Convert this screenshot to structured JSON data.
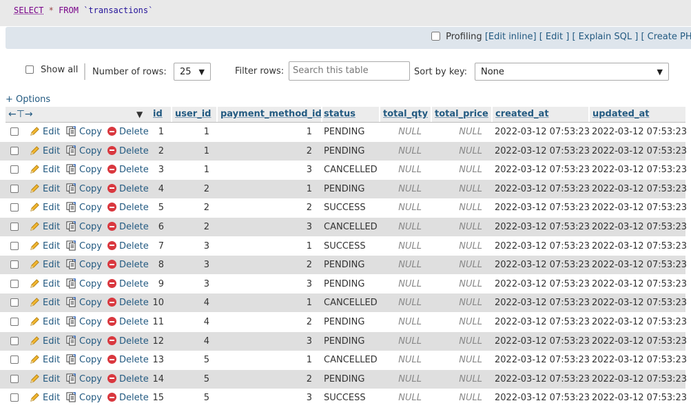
{
  "query": {
    "select_kw": "SELECT",
    "star": "*",
    "from_kw": "FROM",
    "table": "`transactions`"
  },
  "profiling": {
    "label": "Profiling",
    "edit_inline": "[Edit inline]",
    "edit": "[ Edit ]",
    "explain": "[ Explain SQL ]",
    "create_php": "[ Create PHP c"
  },
  "nav": {
    "show_all": "Show all",
    "rows_label": "Number of rows:",
    "rows_value": "25",
    "filter_label": "Filter rows:",
    "filter_placeholder": "Search this table",
    "sort_label": "Sort by key:",
    "sort_value": "None"
  },
  "options_link": "+ Options",
  "columns": [
    "id",
    "user_id",
    "payment_method_id",
    "status",
    "total_qty",
    "total_price",
    "created_at",
    "updated_at"
  ],
  "actions": {
    "edit": "Edit",
    "copy": "Copy",
    "delete": "Delete"
  },
  "rows": [
    {
      "id": "1",
      "user_id": "1",
      "payment_method_id": "1",
      "status": "PENDING",
      "total_qty": "NULL",
      "total_price": "NULL",
      "created_at": "2022-03-12 07:53:23",
      "updated_at": "2022-03-12 07:53:23"
    },
    {
      "id": "2",
      "user_id": "1",
      "payment_method_id": "2",
      "status": "PENDING",
      "total_qty": "NULL",
      "total_price": "NULL",
      "created_at": "2022-03-12 07:53:23",
      "updated_at": "2022-03-12 07:53:23"
    },
    {
      "id": "3",
      "user_id": "1",
      "payment_method_id": "3",
      "status": "CANCELLED",
      "total_qty": "NULL",
      "total_price": "NULL",
      "created_at": "2022-03-12 07:53:23",
      "updated_at": "2022-03-12 07:53:23"
    },
    {
      "id": "4",
      "user_id": "2",
      "payment_method_id": "1",
      "status": "PENDING",
      "total_qty": "NULL",
      "total_price": "NULL",
      "created_at": "2022-03-12 07:53:23",
      "updated_at": "2022-03-12 07:53:23"
    },
    {
      "id": "5",
      "user_id": "2",
      "payment_method_id": "2",
      "status": "SUCCESS",
      "total_qty": "NULL",
      "total_price": "NULL",
      "created_at": "2022-03-12 07:53:23",
      "updated_at": "2022-03-12 07:53:23"
    },
    {
      "id": "6",
      "user_id": "2",
      "payment_method_id": "3",
      "status": "CANCELLED",
      "total_qty": "NULL",
      "total_price": "NULL",
      "created_at": "2022-03-12 07:53:23",
      "updated_at": "2022-03-12 07:53:23"
    },
    {
      "id": "7",
      "user_id": "3",
      "payment_method_id": "1",
      "status": "SUCCESS",
      "total_qty": "NULL",
      "total_price": "NULL",
      "created_at": "2022-03-12 07:53:23",
      "updated_at": "2022-03-12 07:53:23"
    },
    {
      "id": "8",
      "user_id": "3",
      "payment_method_id": "2",
      "status": "PENDING",
      "total_qty": "NULL",
      "total_price": "NULL",
      "created_at": "2022-03-12 07:53:23",
      "updated_at": "2022-03-12 07:53:23"
    },
    {
      "id": "9",
      "user_id": "3",
      "payment_method_id": "3",
      "status": "PENDING",
      "total_qty": "NULL",
      "total_price": "NULL",
      "created_at": "2022-03-12 07:53:23",
      "updated_at": "2022-03-12 07:53:23"
    },
    {
      "id": "10",
      "user_id": "4",
      "payment_method_id": "1",
      "status": "CANCELLED",
      "total_qty": "NULL",
      "total_price": "NULL",
      "created_at": "2022-03-12 07:53:23",
      "updated_at": "2022-03-12 07:53:23"
    },
    {
      "id": "11",
      "user_id": "4",
      "payment_method_id": "2",
      "status": "PENDING",
      "total_qty": "NULL",
      "total_price": "NULL",
      "created_at": "2022-03-12 07:53:23",
      "updated_at": "2022-03-12 07:53:23"
    },
    {
      "id": "12",
      "user_id": "4",
      "payment_method_id": "3",
      "status": "PENDING",
      "total_qty": "NULL",
      "total_price": "NULL",
      "created_at": "2022-03-12 07:53:23",
      "updated_at": "2022-03-12 07:53:23"
    },
    {
      "id": "13",
      "user_id": "5",
      "payment_method_id": "1",
      "status": "CANCELLED",
      "total_qty": "NULL",
      "total_price": "NULL",
      "created_at": "2022-03-12 07:53:23",
      "updated_at": "2022-03-12 07:53:23"
    },
    {
      "id": "14",
      "user_id": "5",
      "payment_method_id": "2",
      "status": "PENDING",
      "total_qty": "NULL",
      "total_price": "NULL",
      "created_at": "2022-03-12 07:53:23",
      "updated_at": "2022-03-12 07:53:23"
    },
    {
      "id": "15",
      "user_id": "5",
      "payment_method_id": "3",
      "status": "SUCCESS",
      "total_qty": "NULL",
      "total_price": "NULL",
      "created_at": "2022-03-12 07:53:23",
      "updated_at": "2022-03-12 07:53:23"
    }
  ]
}
